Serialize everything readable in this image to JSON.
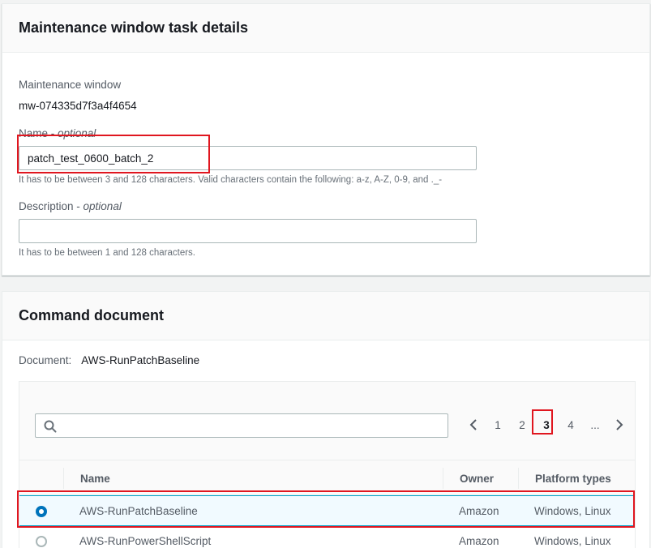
{
  "task_details": {
    "title": "Maintenance window task details",
    "mw_label": "Maintenance window",
    "mw_value": "mw-074335d7f3a4f4654",
    "name_label": "Name",
    "name_optional": "optional",
    "name_value": "patch_test_0600_batch_2",
    "name_hint": "It has to be between 3 and 128 characters. Valid characters contain the following: a-z, A-Z, 0-9, and ._-",
    "desc_label": "Description",
    "desc_optional": "optional",
    "desc_value": "",
    "desc_hint": "It has to be between 1 and 128 characters."
  },
  "command_document": {
    "title": "Command document",
    "doc_label": "Document:",
    "doc_value": "AWS-RunPatchBaseline",
    "search_placeholder": "",
    "pages": [
      "1",
      "2",
      "3",
      "4",
      "..."
    ],
    "current_page": "3",
    "columns": [
      "Name",
      "Owner",
      "Platform types"
    ],
    "rows": [
      {
        "name": "AWS-RunPatchBaseline",
        "owner": "Amazon",
        "platforms": "Windows, Linux",
        "selected": true
      },
      {
        "name": "AWS-RunPowerShellScript",
        "owner": "Amazon",
        "platforms": "Windows, Linux",
        "selected": false
      }
    ]
  },
  "colors": {
    "highlight": "#e0161f",
    "accent": "#0073bb"
  }
}
